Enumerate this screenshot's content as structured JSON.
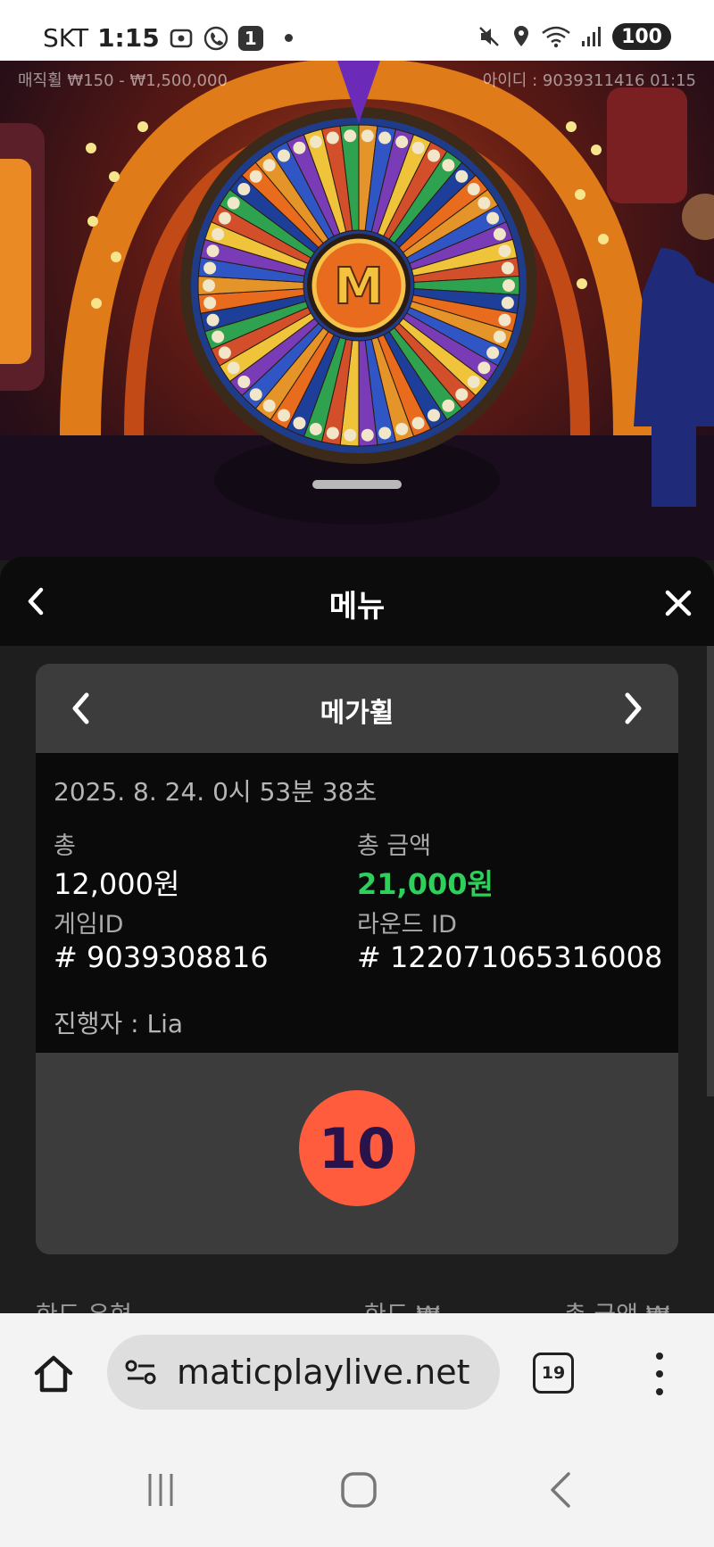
{
  "status_bar": {
    "carrier": "SKT",
    "time": "1:15",
    "notification_badge": "1",
    "battery": "100",
    "icons": [
      "gallery-icon",
      "call-icon",
      "mute-icon",
      "location-icon",
      "wifi-icon",
      "signal-icon"
    ]
  },
  "video": {
    "limit_text": "매직휠 ₩150 - ₩1,500,000",
    "id_text": "아이디 : 9039311416   01:15"
  },
  "menu": {
    "title": "메뉴"
  },
  "history_card": {
    "game_name": "메가휠",
    "date": "2025. 8. 24. 0시 53분 38초",
    "total_label": "총",
    "total_value": "12,000원",
    "total_amount_label": "총 금액",
    "total_amount_value": "21,000원",
    "game_id_label": "게임ID",
    "game_id_value": "# 9039308816",
    "round_id_label": "라운드 ID",
    "round_id_value": "# 122071065316008",
    "host_text": "진행자 : Lia",
    "result_value": "10",
    "result_color": "#ff5b3d"
  },
  "table_header": {
    "col1": "한도 유형",
    "col2": "한도 ₩",
    "col3": "총 금액 ₩"
  },
  "browser": {
    "url": "maticplaylive.net",
    "tab_count": "19"
  }
}
